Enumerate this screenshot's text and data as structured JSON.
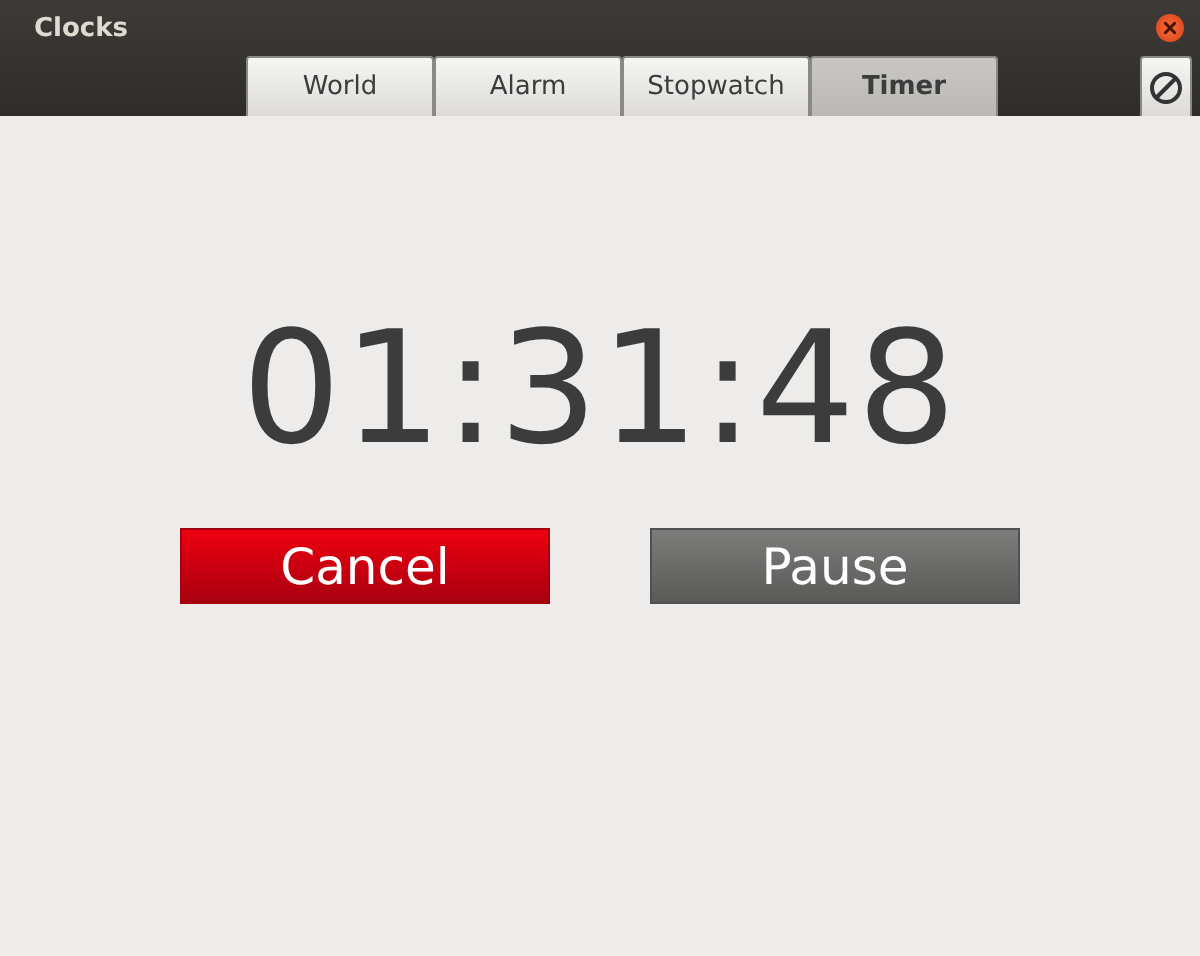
{
  "window": {
    "title": "Clocks"
  },
  "tabs": [
    {
      "label": "World",
      "selected": false
    },
    {
      "label": "Alarm",
      "selected": false
    },
    {
      "label": "Stopwatch",
      "selected": false
    },
    {
      "label": "Timer",
      "selected": true
    }
  ],
  "timer": {
    "time": "01:31:48"
  },
  "buttons": [
    {
      "label": "Cancel",
      "kind": "danger"
    },
    {
      "label": "Pause",
      "kind": "normal"
    }
  ]
}
